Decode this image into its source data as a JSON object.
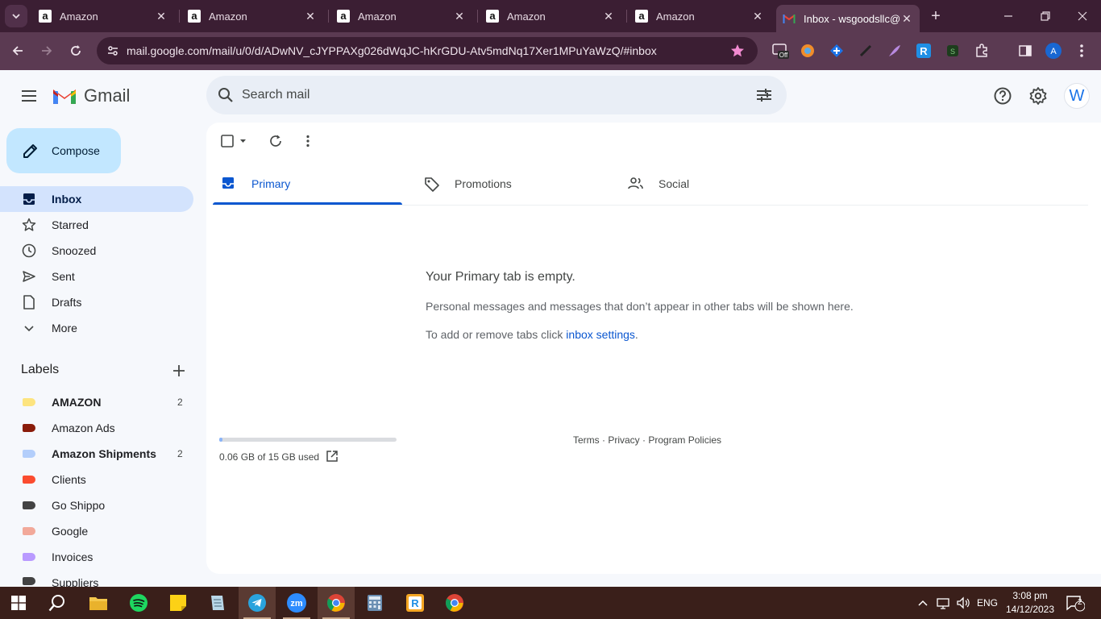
{
  "browser": {
    "tabs": [
      {
        "label": "Amazon",
        "favicon": "amazon-icon"
      },
      {
        "label": "Amazon",
        "favicon": "amazon-icon"
      },
      {
        "label": "Amazon",
        "favicon": "amazon-icon"
      },
      {
        "label": "Amazon",
        "favicon": "amazon-icon"
      },
      {
        "label": "Amazon",
        "favicon": "amazon-icon"
      },
      {
        "label": "Inbox - wsgoodsllc@",
        "favicon": "gmail-icon",
        "active": true
      }
    ],
    "url": "mail.google.com/mail/u/0/d/ADwNV_cJYPPAXg026dWqJC-hKrGDU-Atv5mdNq17Xer1MPuYaWzQ/#inbox",
    "profile_initial": "A",
    "ext_badge": "Off"
  },
  "gmail": {
    "logo_text": "Gmail",
    "search_placeholder": "Search mail",
    "avatar_initial": "W",
    "compose_label": "Compose",
    "nav": [
      {
        "label": "Inbox",
        "icon": "inbox-icon",
        "active": true
      },
      {
        "label": "Starred",
        "icon": "star-icon"
      },
      {
        "label": "Snoozed",
        "icon": "clock-icon"
      },
      {
        "label": "Sent",
        "icon": "send-icon"
      },
      {
        "label": "Drafts",
        "icon": "draft-icon"
      },
      {
        "label": "More",
        "icon": "chevron-down-icon"
      }
    ],
    "labels_heading": "Labels",
    "labels": [
      {
        "label": "AMAZON",
        "color": "#fde47f",
        "count": "2",
        "bold": true
      },
      {
        "label": "Amazon Ads",
        "color": "#8a1c0a",
        "count": "",
        "bold": false
      },
      {
        "label": "Amazon Shipments",
        "color": "#b3cefb",
        "count": "2",
        "bold": true
      },
      {
        "label": "Clients",
        "color": "#fb4c2f",
        "count": "",
        "bold": false
      },
      {
        "label": "Go Shippo",
        "color": "#434343",
        "count": "",
        "bold": false
      },
      {
        "label": "Google",
        "color": "#f2a99a",
        "count": "",
        "bold": false
      },
      {
        "label": "Invoices",
        "color": "#b99aff",
        "count": "",
        "bold": false
      },
      {
        "label": "Suppliers",
        "color": "#434343",
        "count": "",
        "bold": false
      }
    ],
    "category_tabs": [
      {
        "label": "Primary",
        "icon": "inbox-icon",
        "active": true
      },
      {
        "label": "Promotions",
        "icon": "tag-icon"
      },
      {
        "label": "Social",
        "icon": "people-icon"
      }
    ],
    "empty": {
      "title": "Your Primary tab is empty.",
      "description": "Personal messages and messages that don’t appear in other tabs will be shown here.",
      "settings_prefix": "To add or remove tabs click ",
      "settings_link": "inbox settings",
      "settings_suffix": "."
    },
    "storage": {
      "used_text": "0.06 GB of 15 GB used",
      "fraction": 0.004
    },
    "footer": {
      "terms": "Terms",
      "sep1": " · ",
      "privacy": "Privacy",
      "sep2": " · ",
      "policies": "Program Policies"
    }
  },
  "taskbar": {
    "language": "ENG",
    "time": "3:08 pm",
    "date": "14/12/2023",
    "notifications": "2",
    "zoom_label": "zm"
  }
}
